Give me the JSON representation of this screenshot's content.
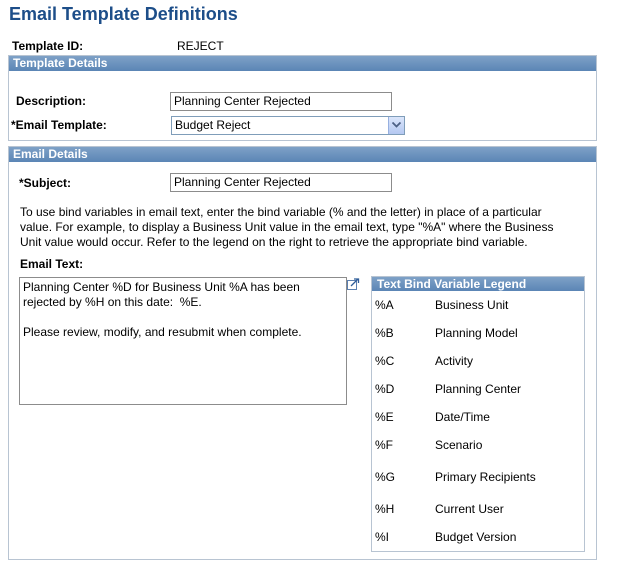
{
  "page": {
    "title": "Email Template Definitions"
  },
  "template": {
    "id_label": "Template ID:",
    "id_value": "REJECT"
  },
  "template_details": {
    "header": "Template Details",
    "description_label": "Description:",
    "description_value": "Planning Center Rejected",
    "email_template_label": "*Email Template:",
    "email_template_value": "Budget Reject",
    "dropdown_icon": "chevron-down-icon"
  },
  "email_details": {
    "header": "Email Details",
    "subject_label": "*Subject:",
    "subject_value": "Planning Center Rejected",
    "instructions": [
      "To use bind variables in email text, enter the bind variable (% and the letter) in place of a particular",
      "value. For example, to display a Business Unit value in the email text, type \"%A\" where the Business",
      "Unit value would occur. Refer to the legend on the right to retrieve the appropriate bind variable."
    ],
    "email_text_label": "Email Text:",
    "email_text_value": "Planning Center %D for Business Unit %A has been\nrejected by %H on this date:  %E.\n\nPlease review, modify, and resubmit when complete.",
    "expand_icon": "expand-icon"
  },
  "legend": {
    "header": "Text Bind Variable Legend",
    "items": [
      {
        "code": "%A",
        "label": "Business Unit"
      },
      {
        "code": "%B",
        "label": "Planning Model"
      },
      {
        "code": "%C",
        "label": "Activity"
      },
      {
        "code": "%D",
        "label": "Planning Center"
      },
      {
        "code": "%E",
        "label": "Date/Time"
      },
      {
        "code": "%F",
        "label": "Scenario"
      },
      {
        "code": "%G",
        "label": "Primary Recipients"
      },
      {
        "code": "%H",
        "label": "Current User"
      },
      {
        "code": "%I",
        "label": "Budget Version"
      }
    ]
  }
}
